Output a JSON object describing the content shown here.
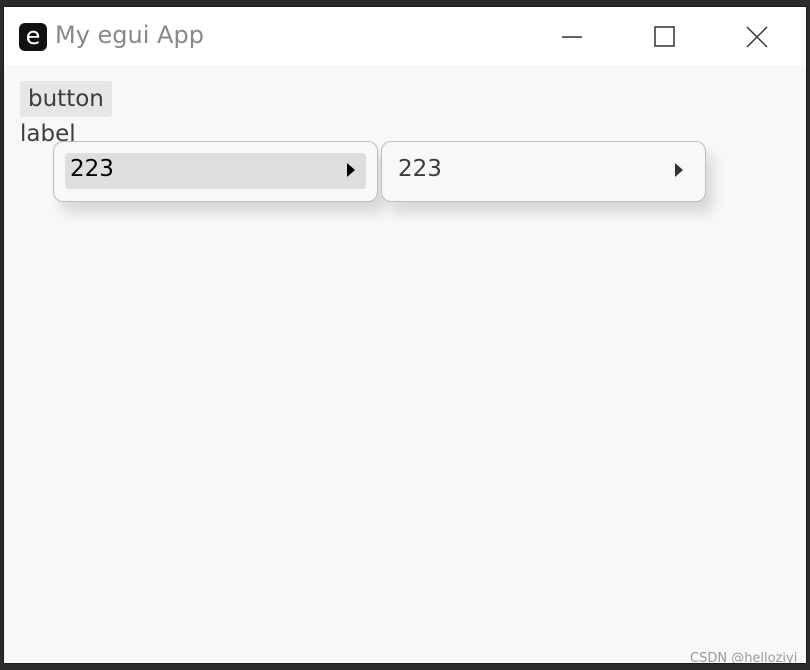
{
  "window": {
    "title": "My egui App",
    "icon_letter": "e",
    "controls": [
      "minimize-icon",
      "maximize-icon",
      "close-icon"
    ]
  },
  "content": {
    "button_label": "button",
    "label_text": "label"
  },
  "menus": [
    {
      "item_label": "223",
      "hovered": true,
      "submenu_icon": "submenu-arrow-icon"
    },
    {
      "item_label": "223",
      "hovered": false,
      "submenu_icon": "submenu-arrow-icon"
    }
  ],
  "watermark": "CSDN @helloziyi",
  "colors": {
    "title_bar": "#ffffff",
    "panel_bg": "#f8f8f8",
    "hover_bg": "#dedede",
    "button_bg": "#e6e6e6",
    "text": "#3c3c3c",
    "title_text": "#888888"
  }
}
